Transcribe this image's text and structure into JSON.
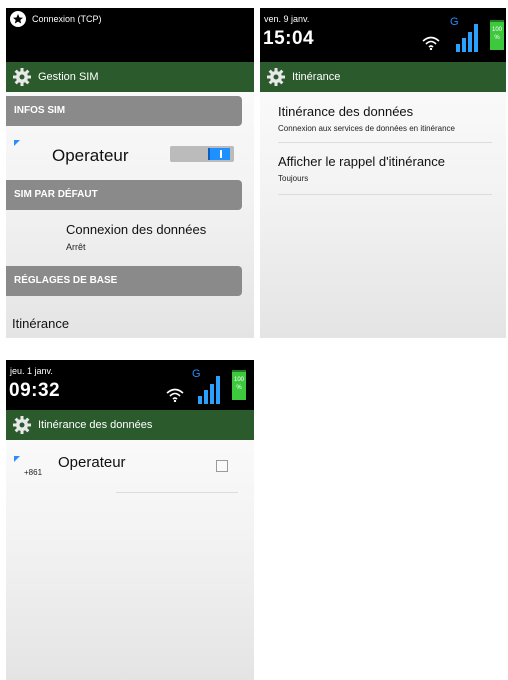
{
  "screen1": {
    "notification": "Connexion (TCP)",
    "header_title": "Gestion SIM",
    "section_infos": "INFOS SIM",
    "operator": "Operateur",
    "section_default": "SIM PAR DÉFAUT",
    "data_conn_title": "Connexion des données",
    "data_conn_value": "Arrêt",
    "section_basic": "RÉGLAGES DE BASE",
    "roaming_label": "Itinérance"
  },
  "screen2": {
    "date": "ven. 9 janv.",
    "time": "15:04",
    "network": "G",
    "battery": "100 %",
    "header_title": "Itinérance",
    "item1_title": "Itinérance des données",
    "item1_sub": "Connexion aux services de données en itinérance",
    "item2_title": "Afficher le rappel d'itinérance",
    "item2_sub": "Toujours"
  },
  "screen3": {
    "date": "jeu. 1 janv.",
    "time": "09:32",
    "network": "G",
    "battery": "100 %",
    "header_title": "Itinérance des données",
    "operator": "Operateur",
    "operator_num": "+861"
  },
  "colors": {
    "header_green": "#2b5b2d",
    "section_gray": "#8a8a8a",
    "accent_blue": "#2a8cff",
    "battery_green": "#3ec83e"
  },
  "icons": [
    "gear-icon",
    "wifi-icon",
    "signal-icon",
    "battery-icon",
    "app-notification-icon",
    "checkbox-icon"
  ]
}
